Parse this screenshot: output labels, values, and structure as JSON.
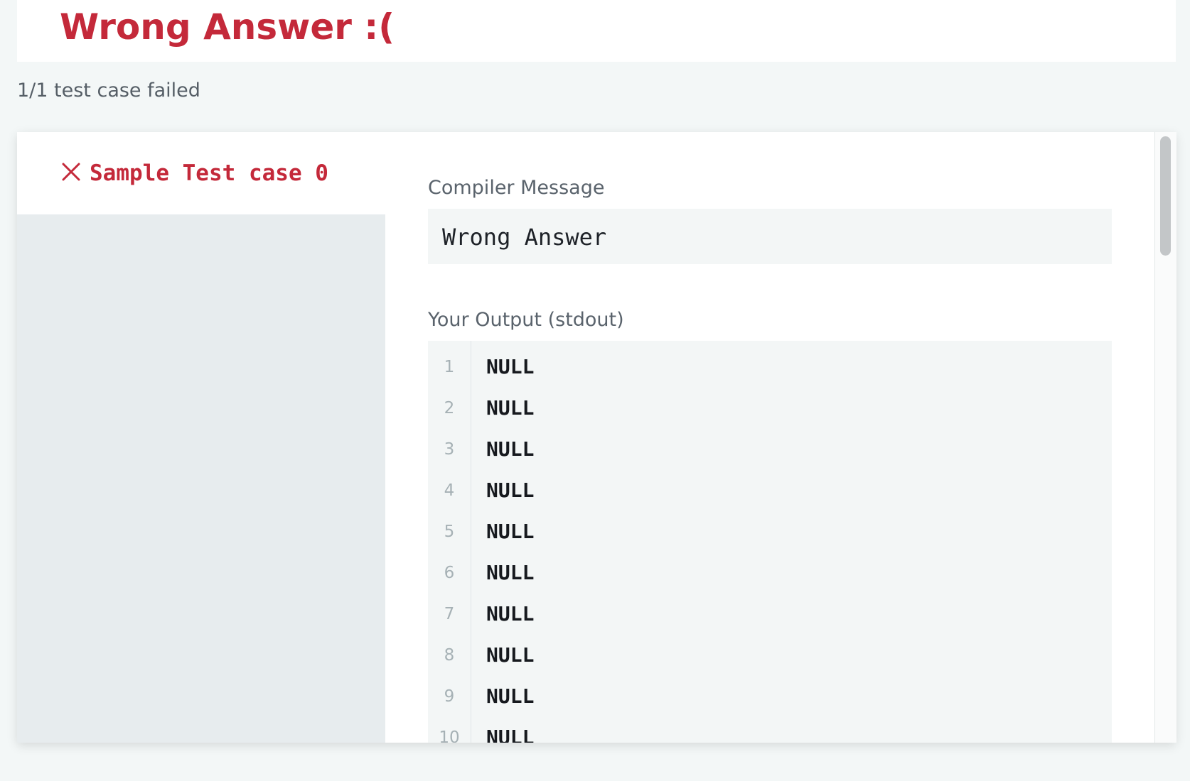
{
  "result": {
    "title": "Wrong Answer :(",
    "summary": "1/1 test case failed"
  },
  "test_cases": [
    {
      "label": "Sample Test case 0",
      "status": "failed",
      "icon": "close-x-icon"
    }
  ],
  "compiler": {
    "label": "Compiler Message",
    "message": "Wrong Answer"
  },
  "output": {
    "label": "Your Output (stdout)",
    "lines": [
      {
        "number": "1",
        "text": "NULL"
      },
      {
        "number": "2",
        "text": "NULL"
      },
      {
        "number": "3",
        "text": "NULL"
      },
      {
        "number": "4",
        "text": "NULL"
      },
      {
        "number": "5",
        "text": "NULL"
      },
      {
        "number": "6",
        "text": "NULL"
      },
      {
        "number": "7",
        "text": "NULL"
      },
      {
        "number": "8",
        "text": "NULL"
      },
      {
        "number": "9",
        "text": "NULL"
      },
      {
        "number": "10",
        "text": "NULL"
      }
    ]
  },
  "colors": {
    "error_red": "#c4293a",
    "page_background": "#f3f7f7",
    "code_background": "#f3f6f6"
  }
}
